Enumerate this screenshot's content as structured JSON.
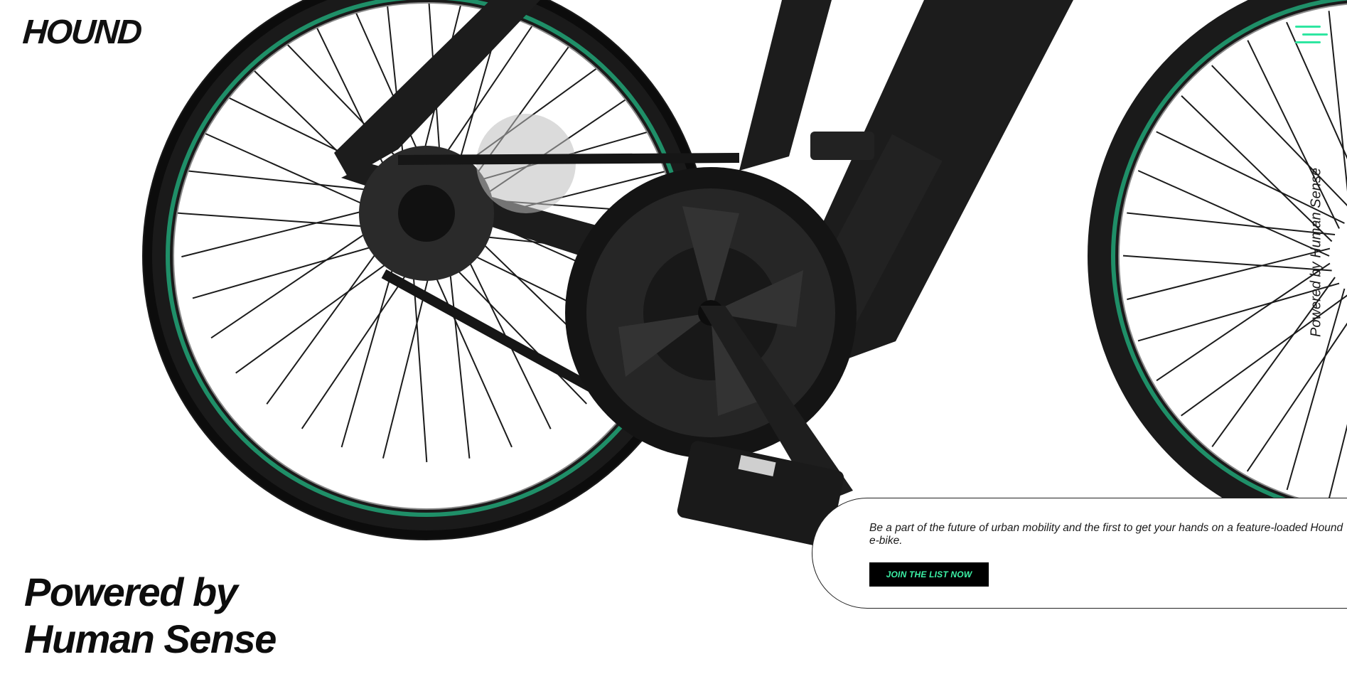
{
  "brand": {
    "logo_text": "HOUND",
    "accent_color": "#2ee6a1",
    "tire_stripe_color": "#1f8f68"
  },
  "header": {
    "menu_icon": "hamburger-menu-icon"
  },
  "hero": {
    "side_caption": "Powered by Human Sense",
    "slides": {
      "count": 2,
      "active_index": 2
    }
  },
  "headline": {
    "line1": "Powered by",
    "line2": "Human Sense"
  },
  "cta": {
    "text": "Be a part of the future of urban mobility and the first to get your hands on a feature-loaded Hound e-bike.",
    "button_label": "JOIN THE LIST NOW"
  }
}
